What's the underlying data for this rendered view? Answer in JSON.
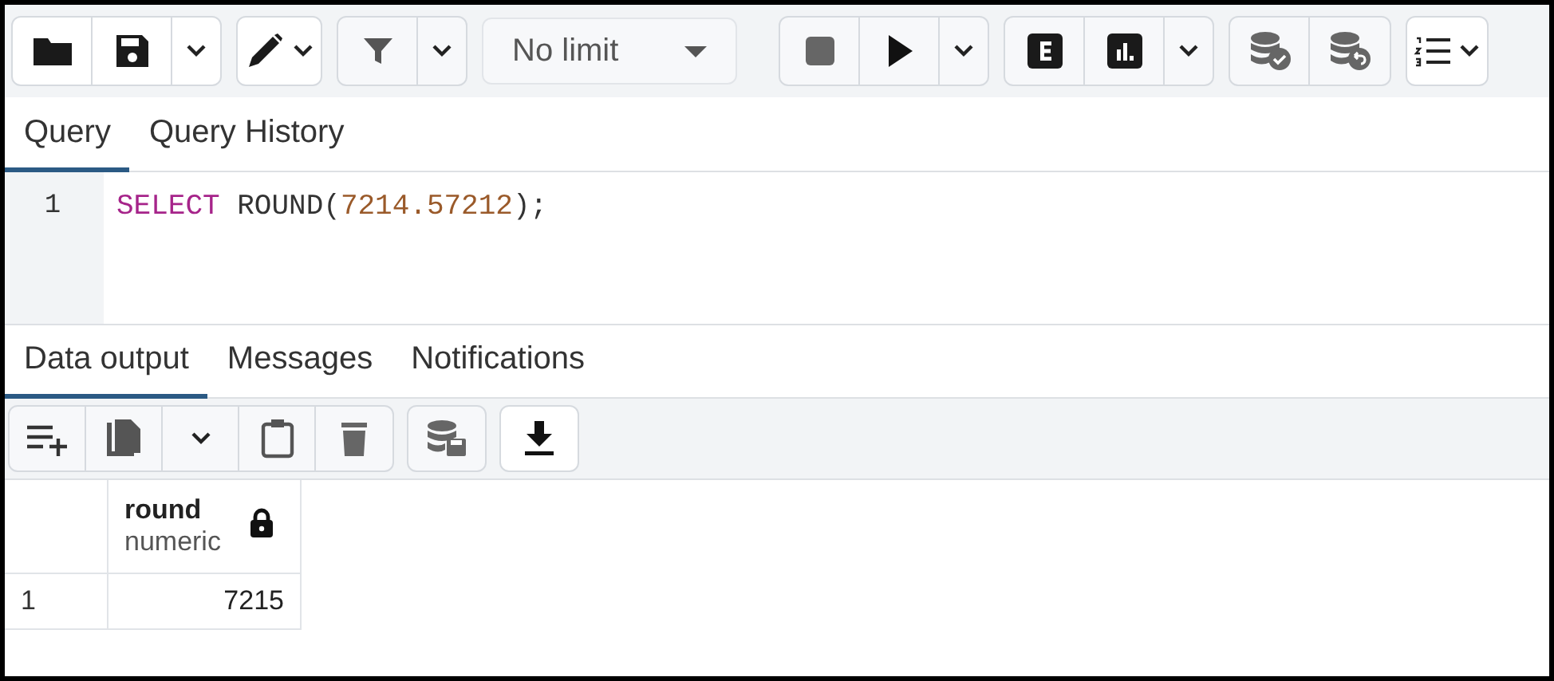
{
  "toolbar": {
    "row_limit": "No limit"
  },
  "query_tabs": [
    {
      "label": "Query",
      "selected": true
    },
    {
      "label": "Query History",
      "selected": false
    }
  ],
  "editor": {
    "lines": [
      {
        "number": "1",
        "tokens": [
          {
            "kind": "keyword",
            "text": "SELECT"
          },
          {
            "kind": "plain",
            "text": " ROUND("
          },
          {
            "kind": "number",
            "text": "7214.57212"
          },
          {
            "kind": "plain",
            "text": ");"
          }
        ]
      }
    ]
  },
  "result_tabs": [
    {
      "label": "Data output",
      "selected": true
    },
    {
      "label": "Messages",
      "selected": false
    },
    {
      "label": "Notifications",
      "selected": false
    }
  ],
  "grid": {
    "columns": [
      {
        "name": "round",
        "type": "numeric",
        "locked": true
      }
    ],
    "rows": [
      {
        "number": "1",
        "cells": [
          "7215"
        ]
      }
    ]
  }
}
